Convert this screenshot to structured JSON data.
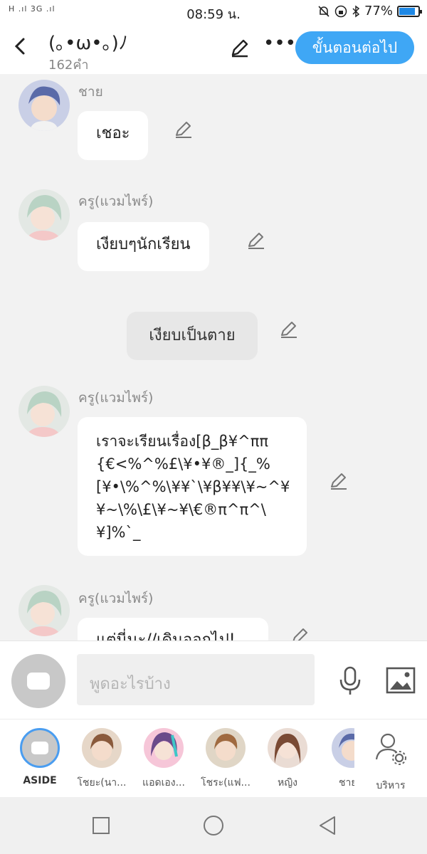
{
  "status": {
    "network": "H .ıl 3G .ıl",
    "time": "08:59 น.",
    "battery": "77%",
    "battery_level": 0.77
  },
  "header": {
    "title": "(｡•ω•｡)ﾉ",
    "word_count": "162คำ",
    "next_button": "ขั้นตอนต่อไป"
  },
  "messages": [
    {
      "type": "char",
      "name": "ชาย",
      "text": "เชอะ"
    },
    {
      "type": "char",
      "name": "ครู(แวมไพร์)",
      "text": "เงียบๆนักเรียน"
    },
    {
      "type": "narration",
      "text": "เงียบเป็นตาย"
    },
    {
      "type": "char",
      "name": "ครู(แวมไพร์)",
      "text": "เราจะเรียนเรื่อง[β_β¥^ππ{€<%^%£\\¥•¥®_]{_%[¥•\\%^%\\¥¥`\\¥β¥¥\\¥~^¥¥~\\%\\£\\¥~¥\\€®π^π^\\¥]%`_"
    },
    {
      "type": "char",
      "name": "ครู(แวมไพร์)",
      "text": "แต่นี่นะ//เดินออกไป!"
    }
  ],
  "input": {
    "placeholder": "พูดอะไรบ้าง"
  },
  "characters": [
    {
      "label": "ASIDE"
    },
    {
      "label": "โชยะ(นา..."
    },
    {
      "label": "แอดเอง..."
    },
    {
      "label": "โชระ(แฟ..."
    },
    {
      "label": "หญิง"
    },
    {
      "label": "ชาย"
    },
    {
      "label": "บริหาร"
    }
  ],
  "colors": {
    "accent": "#3fa7f5",
    "bubble": "#ffffff",
    "background": "#f2f2f2"
  }
}
